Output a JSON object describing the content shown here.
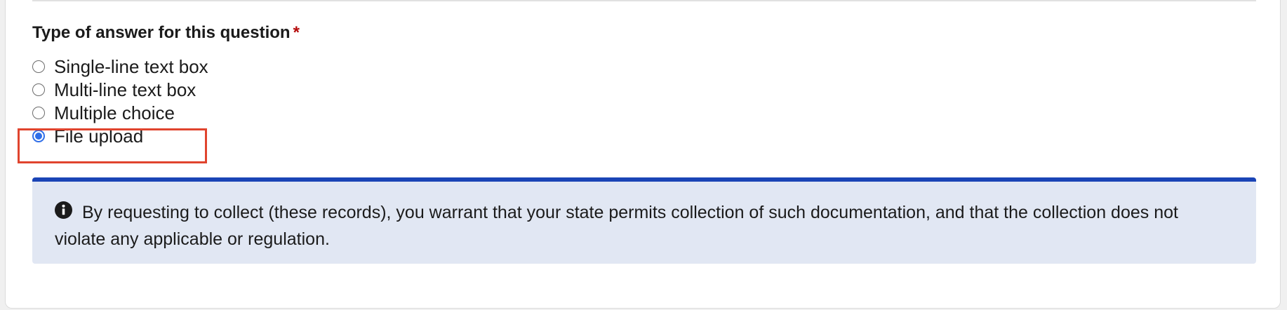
{
  "question": {
    "label": "Type of answer for this question",
    "required_marker": "*"
  },
  "answer_options": [
    {
      "label": "Single-line text box",
      "selected": false
    },
    {
      "label": "Multi-line text box",
      "selected": false
    },
    {
      "label": "Multiple choice",
      "selected": false
    },
    {
      "label": "File upload",
      "selected": true
    }
  ],
  "notice": {
    "icon": "info-circle-icon",
    "text": "By requesting to collect (these records), you warrant that your state permits collection of such documentation, and that the collection does not violate any applicable or regulation."
  },
  "colors": {
    "accent": "#2f6ee8",
    "required": "#b50909",
    "highlight": "#e0442e",
    "notice_border": "#1a44b6",
    "notice_background": "#e1e7f3"
  }
}
